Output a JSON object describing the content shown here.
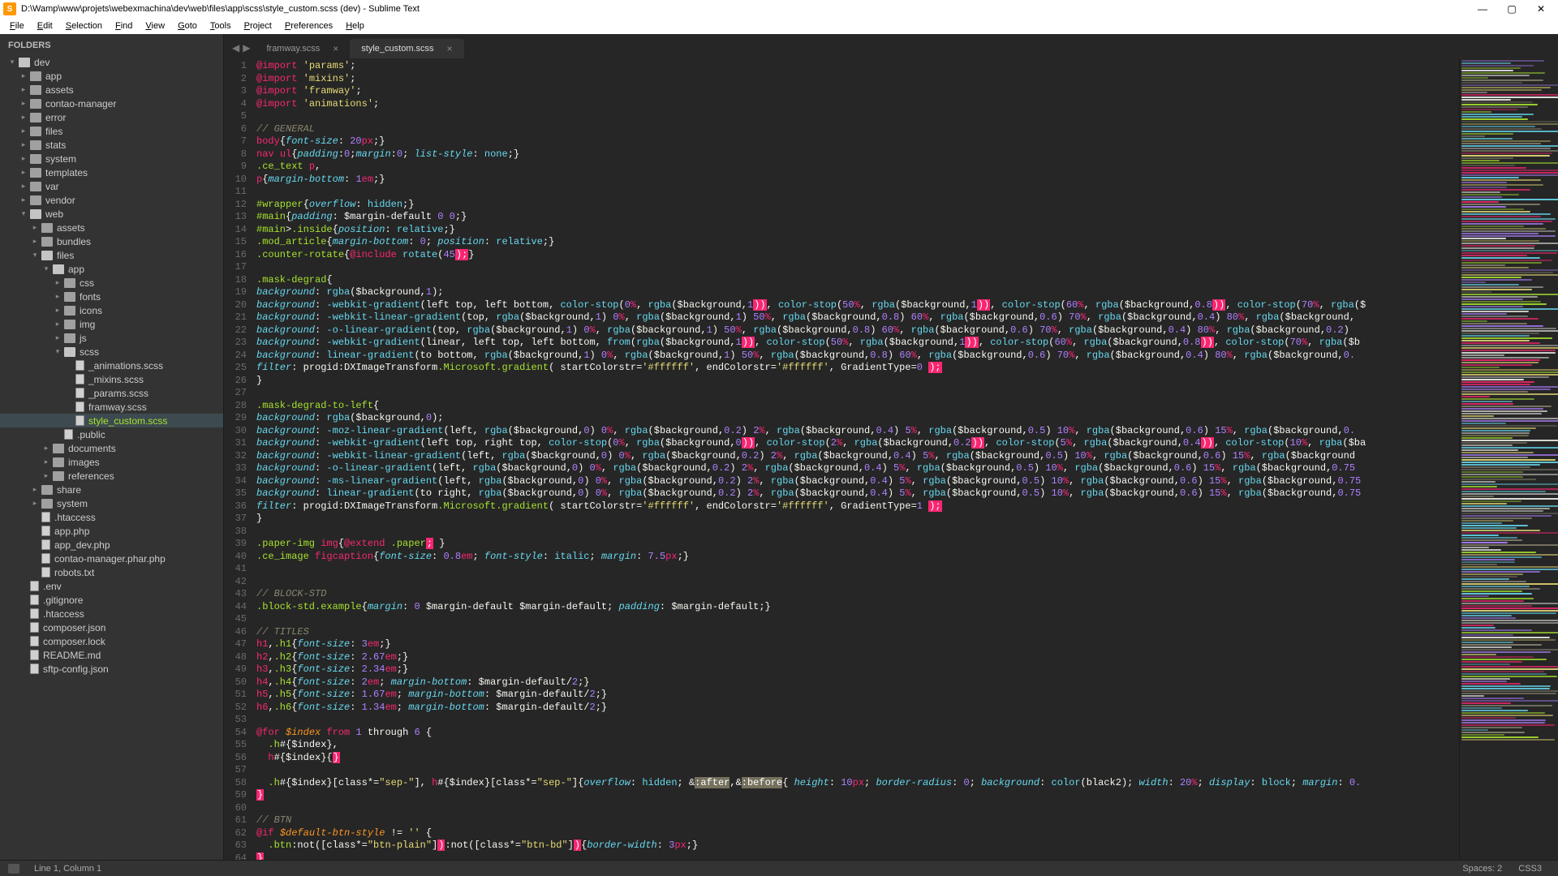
{
  "window": {
    "title": "D:\\Wamp\\www\\projets\\webexmachina\\dev\\web\\files\\app\\scss\\style_custom.scss (dev) - Sublime Text",
    "min": "—",
    "max": "▢",
    "close": "✕"
  },
  "menu": [
    "File",
    "Edit",
    "Selection",
    "Find",
    "View",
    "Goto",
    "Tools",
    "Project",
    "Preferences",
    "Help"
  ],
  "sidebar": {
    "header": "FOLDERS",
    "tree": [
      {
        "d": 0,
        "t": "folder",
        "o": true,
        "n": "dev"
      },
      {
        "d": 1,
        "t": "folder",
        "o": false,
        "n": "app"
      },
      {
        "d": 1,
        "t": "folder",
        "o": false,
        "n": "assets"
      },
      {
        "d": 1,
        "t": "folder",
        "o": false,
        "n": "contao-manager"
      },
      {
        "d": 1,
        "t": "folder",
        "o": false,
        "n": "error"
      },
      {
        "d": 1,
        "t": "folder",
        "o": false,
        "n": "files"
      },
      {
        "d": 1,
        "t": "folder",
        "o": false,
        "n": "stats"
      },
      {
        "d": 1,
        "t": "folder",
        "o": false,
        "n": "system"
      },
      {
        "d": 1,
        "t": "folder",
        "o": false,
        "n": "templates"
      },
      {
        "d": 1,
        "t": "folder",
        "o": false,
        "n": "var"
      },
      {
        "d": 1,
        "t": "folder",
        "o": false,
        "n": "vendor"
      },
      {
        "d": 1,
        "t": "folder",
        "o": true,
        "n": "web"
      },
      {
        "d": 2,
        "t": "folder",
        "o": false,
        "n": "assets"
      },
      {
        "d": 2,
        "t": "folder",
        "o": false,
        "n": "bundles"
      },
      {
        "d": 2,
        "t": "folder",
        "o": true,
        "n": "files"
      },
      {
        "d": 3,
        "t": "folder",
        "o": true,
        "n": "app"
      },
      {
        "d": 4,
        "t": "folder",
        "o": false,
        "n": "css"
      },
      {
        "d": 4,
        "t": "folder",
        "o": false,
        "n": "fonts"
      },
      {
        "d": 4,
        "t": "folder",
        "o": false,
        "n": "icons"
      },
      {
        "d": 4,
        "t": "folder",
        "o": false,
        "n": "img"
      },
      {
        "d": 4,
        "t": "folder",
        "o": false,
        "n": "js"
      },
      {
        "d": 4,
        "t": "folder",
        "o": true,
        "n": "scss"
      },
      {
        "d": 5,
        "t": "file",
        "n": "_animations.scss"
      },
      {
        "d": 5,
        "t": "file",
        "n": "_mixins.scss"
      },
      {
        "d": 5,
        "t": "file",
        "n": "_params.scss"
      },
      {
        "d": 5,
        "t": "file",
        "n": "framway.scss"
      },
      {
        "d": 5,
        "t": "file",
        "n": "style_custom.scss",
        "sel": true
      },
      {
        "d": 4,
        "t": "file",
        "n": ".public"
      },
      {
        "d": 3,
        "t": "folder",
        "o": false,
        "n": "documents"
      },
      {
        "d": 3,
        "t": "folder",
        "o": false,
        "n": "images"
      },
      {
        "d": 3,
        "t": "folder",
        "o": false,
        "n": "references"
      },
      {
        "d": 2,
        "t": "folder",
        "o": false,
        "n": "share"
      },
      {
        "d": 2,
        "t": "folder",
        "o": false,
        "n": "system"
      },
      {
        "d": 2,
        "t": "file",
        "n": ".htaccess"
      },
      {
        "d": 2,
        "t": "file",
        "n": "app.php"
      },
      {
        "d": 2,
        "t": "file",
        "n": "app_dev.php"
      },
      {
        "d": 2,
        "t": "file",
        "n": "contao-manager.phar.php"
      },
      {
        "d": 2,
        "t": "file",
        "n": "robots.txt"
      },
      {
        "d": 1,
        "t": "file",
        "n": ".env"
      },
      {
        "d": 1,
        "t": "file",
        "n": ".gitignore"
      },
      {
        "d": 1,
        "t": "file",
        "n": ".htaccess"
      },
      {
        "d": 1,
        "t": "file",
        "n": "composer.json"
      },
      {
        "d": 1,
        "t": "file",
        "n": "composer.lock"
      },
      {
        "d": 1,
        "t": "file",
        "n": "README.md"
      },
      {
        "d": 1,
        "t": "file",
        "n": "sftp-config.json"
      }
    ]
  },
  "tabs": [
    {
      "label": "framway.scss",
      "active": false
    },
    {
      "label": "style_custom.scss",
      "active": true
    }
  ],
  "nav": {
    "back": "◀",
    "fwd": "▶"
  },
  "code": {
    "first_line": 1,
    "lines": [
      "<span class='kw2'>@import</span> <span class='st'>'params'</span>;",
      "<span class='kw2'>@import</span> <span class='st'>'mixins'</span>;",
      "<span class='kw2'>@import</span> <span class='st'>'framway'</span>;",
      "<span class='kw2'>@import</span> <span class='st'>'animations'</span>;",
      "",
      "<span class='cm'>// GENERAL</span>",
      "<span class='tag'>body</span>{<span class='prop'>font-size</span>: <span class='num'>20</span><span class='unit'>px</span>;}",
      "<span class='tag'>nav</span> <span class='tag'>ul</span>{<span class='prop'>padding</span>:<span class='num'>0</span>;<span class='prop'>margin</span>:<span class='num'>0</span>; <span class='prop'>list-style</span>: <span class='fn'>none</span>;}",
      "<span class='sel'>.ce_text</span> <span class='tag'>p</span>,",
      "<span class='tag'>p</span>{<span class='prop'>margin-bottom</span>: <span class='num'>1</span><span class='unit'>em</span>;}",
      "",
      "<span class='sel'>#wrapper</span>{<span class='prop'>overflow</span>: <span class='fn'>hidden</span>;}",
      "<span class='sel'>#main</span>{<span class='prop'>padding</span>: $margin-default <span class='num'>0</span> <span class='num'>0</span>;}",
      "<span class='sel'>#main</span>&gt;<span class='sel'>.inside</span>{<span class='prop'>position</span>: <span class='fn'>relative</span>;}",
      "<span class='sel'>.mod_article</span>{<span class='prop'>margin-bottom</span>: <span class='num'>0</span>; <span class='prop'>position</span>: <span class='fn'>relative</span>;}",
      "<span class='sel'>.counter-rotate</span>{<span class='kw2'>@include</span> <span class='fn'>rotate</span>(<span class='num'>45</span><span class='err'>);</span>}",
      "",
      "<span class='sel'>.mask-degrad</span>{",
      "<span class='prop'>background</span>: <span class='fn'>rgba</span>($background,<span class='num'>1</span>);",
      "<span class='prop'>background</span>: <span class='fn'>-webkit-gradient</span>(left top, left bottom, <span class='fn'>color-stop</span>(<span class='num'>0</span><span class='unit'>%</span>, <span class='fn'>rgba</span>($background,<span class='num'>1</span><span class='err'>))</span>, <span class='fn'>color-stop</span>(<span class='num'>50</span><span class='unit'>%</span>, <span class='fn'>rgba</span>($background,<span class='num'>1</span><span class='err'>))</span>, <span class='fn'>color-stop</span>(<span class='num'>60</span><span class='unit'>%</span>, <span class='fn'>rgba</span>($background,<span class='num'>0.8</span><span class='err'>))</span>, <span class='fn'>color-stop</span>(<span class='num'>70</span><span class='unit'>%</span>, <span class='fn'>rgba</span>($",
      "<span class='prop'>background</span>: <span class='fn'>-webkit-linear-gradient</span>(top, <span class='fn'>rgba</span>($background,<span class='num'>1</span>) <span class='num'>0</span><span class='unit'>%</span>, <span class='fn'>rgba</span>($background,<span class='num'>1</span>) <span class='num'>50</span><span class='unit'>%</span>, <span class='fn'>rgba</span>($background,<span class='num'>0.8</span>) <span class='num'>60</span><span class='unit'>%</span>, <span class='fn'>rgba</span>($background,<span class='num'>0.6</span>) <span class='num'>70</span><span class='unit'>%</span>, <span class='fn'>rgba</span>($background,<span class='num'>0.4</span>) <span class='num'>80</span><span class='unit'>%</span>, <span class='fn'>rgba</span>($background,",
      "<span class='prop'>background</span>: <span class='fn'>-o-linear-gradient</span>(top, <span class='fn'>rgba</span>($background,<span class='num'>1</span>) <span class='num'>0</span><span class='unit'>%</span>, <span class='fn'>rgba</span>($background,<span class='num'>1</span>) <span class='num'>50</span><span class='unit'>%</span>, <span class='fn'>rgba</span>($background,<span class='num'>0.8</span>) <span class='num'>60</span><span class='unit'>%</span>, <span class='fn'>rgba</span>($background,<span class='num'>0.6</span>) <span class='num'>70</span><span class='unit'>%</span>, <span class='fn'>rgba</span>($background,<span class='num'>0.4</span>) <span class='num'>80</span><span class='unit'>%</span>, <span class='fn'>rgba</span>($background,<span class='num'>0.2</span>) ",
      "<span class='prop'>background</span>: <span class='fn'>-webkit-gradient</span>(linear, left top, left bottom, <span class='fn'>from</span>(<span class='fn'>rgba</span>($background,<span class='num'>1</span><span class='err'>))</span>, <span class='fn'>color-stop</span>(<span class='num'>50</span><span class='unit'>%</span>, <span class='fn'>rgba</span>($background,<span class='num'>1</span><span class='err'>))</span>, <span class='fn'>color-stop</span>(<span class='num'>60</span><span class='unit'>%</span>, <span class='fn'>rgba</span>($background,<span class='num'>0.8</span><span class='err'>))</span>, <span class='fn'>color-stop</span>(<span class='num'>70</span><span class='unit'>%</span>, <span class='fn'>rgba</span>($b",
      "<span class='prop'>background</span>: <span class='fn'>linear-gradient</span>(to bottom, <span class='fn'>rgba</span>($background,<span class='num'>1</span>) <span class='num'>0</span><span class='unit'>%</span>, <span class='fn'>rgba</span>($background,<span class='num'>1</span>) <span class='num'>50</span><span class='unit'>%</span>, <span class='fn'>rgba</span>($background,<span class='num'>0.8</span>) <span class='num'>60</span><span class='unit'>%</span>, <span class='fn'>rgba</span>($background,<span class='num'>0.6</span>) <span class='num'>70</span><span class='unit'>%</span>, <span class='fn'>rgba</span>($background,<span class='num'>0.4</span>) <span class='num'>80</span><span class='unit'>%</span>, <span class='fn'>rgba</span>($background,<span class='num'>0.</span>",
      "<span class='prop'>filter</span>: progid:DXImageTransform<span class='sel'>.Microsoft.gradient</span>( startColorstr=<span class='st'>'#ffffff'</span>, endColorstr=<span class='st'>'#ffffff'</span>, GradientType=<span class='num'>0</span> <span class='err'>);</span>",
      "}",
      "",
      "<span class='sel'>.mask-degrad-to-left</span>{",
      "<span class='prop'>background</span>: <span class='fn'>rgba</span>($background,<span class='num'>0</span>);",
      "<span class='prop'>background</span>: <span class='fn'>-moz-linear-gradient</span>(left, <span class='fn'>rgba</span>($background,<span class='num'>0</span>) <span class='num'>0</span><span class='unit'>%</span>, <span class='fn'>rgba</span>($background,<span class='num'>0.2</span>) <span class='num'>2</span><span class='unit'>%</span>, <span class='fn'>rgba</span>($background,<span class='num'>0.4</span>) <span class='num'>5</span><span class='unit'>%</span>, <span class='fn'>rgba</span>($background,<span class='num'>0.5</span>) <span class='num'>10</span><span class='unit'>%</span>, <span class='fn'>rgba</span>($background,<span class='num'>0.6</span>) <span class='num'>15</span><span class='unit'>%</span>, <span class='fn'>rgba</span>($background,<span class='num'>0.</span>",
      "<span class='prop'>background</span>: <span class='fn'>-webkit-gradient</span>(left top, right top, <span class='fn'>color-stop</span>(<span class='num'>0</span><span class='unit'>%</span>, <span class='fn'>rgba</span>($background,<span class='num'>0</span><span class='err'>))</span>, <span class='fn'>color-stop</span>(<span class='num'>2</span><span class='unit'>%</span>, <span class='fn'>rgba</span>($background,<span class='num'>0.2</span><span class='err'>))</span>, <span class='fn'>color-stop</span>(<span class='num'>5</span><span class='unit'>%</span>, <span class='fn'>rgba</span>($background,<span class='num'>0.4</span><span class='err'>))</span>, <span class='fn'>color-stop</span>(<span class='num'>10</span><span class='unit'>%</span>, <span class='fn'>rgba</span>($ba",
      "<span class='prop'>background</span>: <span class='fn'>-webkit-linear-gradient</span>(left, <span class='fn'>rgba</span>($background,<span class='num'>0</span>) <span class='num'>0</span><span class='unit'>%</span>, <span class='fn'>rgba</span>($background,<span class='num'>0.2</span>) <span class='num'>2</span><span class='unit'>%</span>, <span class='fn'>rgba</span>($background,<span class='num'>0.4</span>) <span class='num'>5</span><span class='unit'>%</span>, <span class='fn'>rgba</span>($background,<span class='num'>0.5</span>) <span class='num'>10</span><span class='unit'>%</span>, <span class='fn'>rgba</span>($background,<span class='num'>0.6</span>) <span class='num'>15</span><span class='unit'>%</span>, <span class='fn'>rgba</span>($background",
      "<span class='prop'>background</span>: <span class='fn'>-o-linear-gradient</span>(left, <span class='fn'>rgba</span>($background,<span class='num'>0</span>) <span class='num'>0</span><span class='unit'>%</span>, <span class='fn'>rgba</span>($background,<span class='num'>0.2</span>) <span class='num'>2</span><span class='unit'>%</span>, <span class='fn'>rgba</span>($background,<span class='num'>0.4</span>) <span class='num'>5</span><span class='unit'>%</span>, <span class='fn'>rgba</span>($background,<span class='num'>0.5</span>) <span class='num'>10</span><span class='unit'>%</span>, <span class='fn'>rgba</span>($background,<span class='num'>0.6</span>) <span class='num'>15</span><span class='unit'>%</span>, <span class='fn'>rgba</span>($background,<span class='num'>0.75</span>",
      "<span class='prop'>background</span>: <span class='fn'>-ms-linear-gradient</span>(left, <span class='fn'>rgba</span>($background,<span class='num'>0</span>) <span class='num'>0</span><span class='unit'>%</span>, <span class='fn'>rgba</span>($background,<span class='num'>0.2</span>) <span class='num'>2</span><span class='unit'>%</span>, <span class='fn'>rgba</span>($background,<span class='num'>0.4</span>) <span class='num'>5</span><span class='unit'>%</span>, <span class='fn'>rgba</span>($background,<span class='num'>0.5</span>) <span class='num'>10</span><span class='unit'>%</span>, <span class='fn'>rgba</span>($background,<span class='num'>0.6</span>) <span class='num'>15</span><span class='unit'>%</span>, <span class='fn'>rgba</span>($background,<span class='num'>0.75</span>",
      "<span class='prop'>background</span>: <span class='fn'>linear-gradient</span>(to right, <span class='fn'>rgba</span>($background,<span class='num'>0</span>) <span class='num'>0</span><span class='unit'>%</span>, <span class='fn'>rgba</span>($background,<span class='num'>0.2</span>) <span class='num'>2</span><span class='unit'>%</span>, <span class='fn'>rgba</span>($background,<span class='num'>0.4</span>) <span class='num'>5</span><span class='unit'>%</span>, <span class='fn'>rgba</span>($background,<span class='num'>0.5</span>) <span class='num'>10</span><span class='unit'>%</span>, <span class='fn'>rgba</span>($background,<span class='num'>0.6</span>) <span class='num'>15</span><span class='unit'>%</span>, <span class='fn'>rgba</span>($background,<span class='num'>0.75</span>",
      "<span class='prop'>filter</span>: progid:DXImageTransform<span class='sel'>.Microsoft.gradient</span>( startColorstr=<span class='st'>'#ffffff'</span>, endColorstr=<span class='st'>'#ffffff'</span>, GradientType=<span class='num'>1</span> <span class='err'>);</span>",
      "}",
      "",
      "<span class='sel'>.paper-img</span> <span class='tag'>img</span>{<span class='kw2'>@extend</span> <span class='sel'>.paper</span><span class='err'>;</span> }",
      "<span class='sel'>.ce_image</span> <span class='tag'>figcaption</span>{<span class='prop'>font-size</span>: <span class='num'>0.8</span><span class='unit'>em</span>; <span class='prop'>font-style</span>: <span class='fn'>italic</span>; <span class='prop'>margin</span>: <span class='num'>7.5</span><span class='unit'>px</span>;}",
      "",
      "",
      "<span class='cm'>// BLOCK-STD</span>",
      "<span class='sel'>.block-std.example</span>{<span class='prop'>margin</span>: <span class='num'>0</span> $margin-default $margin-default; <span class='prop'>padding</span>: $margin-default;}",
      "",
      "<span class='cm'>// TITLES</span>",
      "<span class='tag'>h1</span>,<span class='sel'>.h1</span>{<span class='prop'>font-size</span>: <span class='num'>3</span><span class='unit'>em</span>;}",
      "<span class='tag'>h2</span>,<span class='sel'>.h2</span>{<span class='prop'>font-size</span>: <span class='num'>2.67</span><span class='unit'>em</span>;}",
      "<span class='tag'>h3</span>,<span class='sel'>.h3</span>{<span class='prop'>font-size</span>: <span class='num'>2.34</span><span class='unit'>em</span>;}",
      "<span class='tag'>h4</span>,<span class='sel'>.h4</span>{<span class='prop'>font-size</span>: <span class='num'>2</span><span class='unit'>em</span>; <span class='prop'>margin-bottom</span>: $margin-default/<span class='num'>2</span>;}",
      "<span class='tag'>h5</span>,<span class='sel'>.h5</span>{<span class='prop'>font-size</span>: <span class='num'>1.67</span><span class='unit'>em</span>; <span class='prop'>margin-bottom</span>: $margin-default/<span class='num'>2</span>;}",
      "<span class='tag'>h6</span>,<span class='sel'>.h6</span>{<span class='prop'>font-size</span>: <span class='num'>1.34</span><span class='unit'>em</span>; <span class='prop'>margin-bottom</span>: $margin-default/<span class='num'>2</span>;}",
      "",
      "<span class='kw2'>@for</span> <span class='var'>$index</span> <span class='kw2'>from</span> <span class='num'>1</span> through <span class='num'>6</span> {",
      "  <span class='sel'>.h</span>#{$index},",
      "  <span class='tag'>h</span>#{$index}{<span class='err'>}</span>",
      "",
      "  <span class='sel'>.h</span>#{$index}[class*=<span class='st'>\"sep-\"</span>], <span class='tag'>h</span>#{$index}[class*=<span class='st'>\"sep-\"</span>]{<span class='prop'>overflow</span>: <span class='fn'>hidden</span>; &amp;<span class='hlps'>:after</span>,&amp;<span class='hlps'>:before</span>{ <span class='prop'>height</span>: <span class='num'>10</span><span class='unit'>px</span>; <span class='prop'>border-radius</span>: <span class='num'>0</span>; <span class='prop'>background</span>: <span class='fn'>color</span>(black2); <span class='prop'>width</span>: <span class='num'>20</span><span class='unit'>%</span>; <span class='prop'>display</span>: <span class='fn'>block</span>; <span class='prop'>margin</span>: <span class='num'>0.</span>",
      "<span class='err'>}</span>",
      "",
      "<span class='cm'>// BTN</span>",
      "<span class='kw2'>@if</span> <span class='var'>$default-btn-style</span> != <span class='st'>''</span> {",
      "  <span class='sel'>.btn</span>:not([class*=<span class='st'>\"btn-plain\"</span>]<span class='err'>)</span>:not([class*=<span class='st'>\"btn-bd\"</span>]<span class='err'>)</span>{<span class='prop'>border-width</span>: <span class='num'>3</span><span class='unit'>px</span>;}",
      "<span class='err'>}</span>"
    ]
  },
  "status": {
    "left": "Line 1, Column 1",
    "spaces": "Spaces: 2",
    "lang": "CSS3"
  },
  "colors": {
    "bg": "#262626",
    "panel": "#333333",
    "accent": "#f92672"
  }
}
